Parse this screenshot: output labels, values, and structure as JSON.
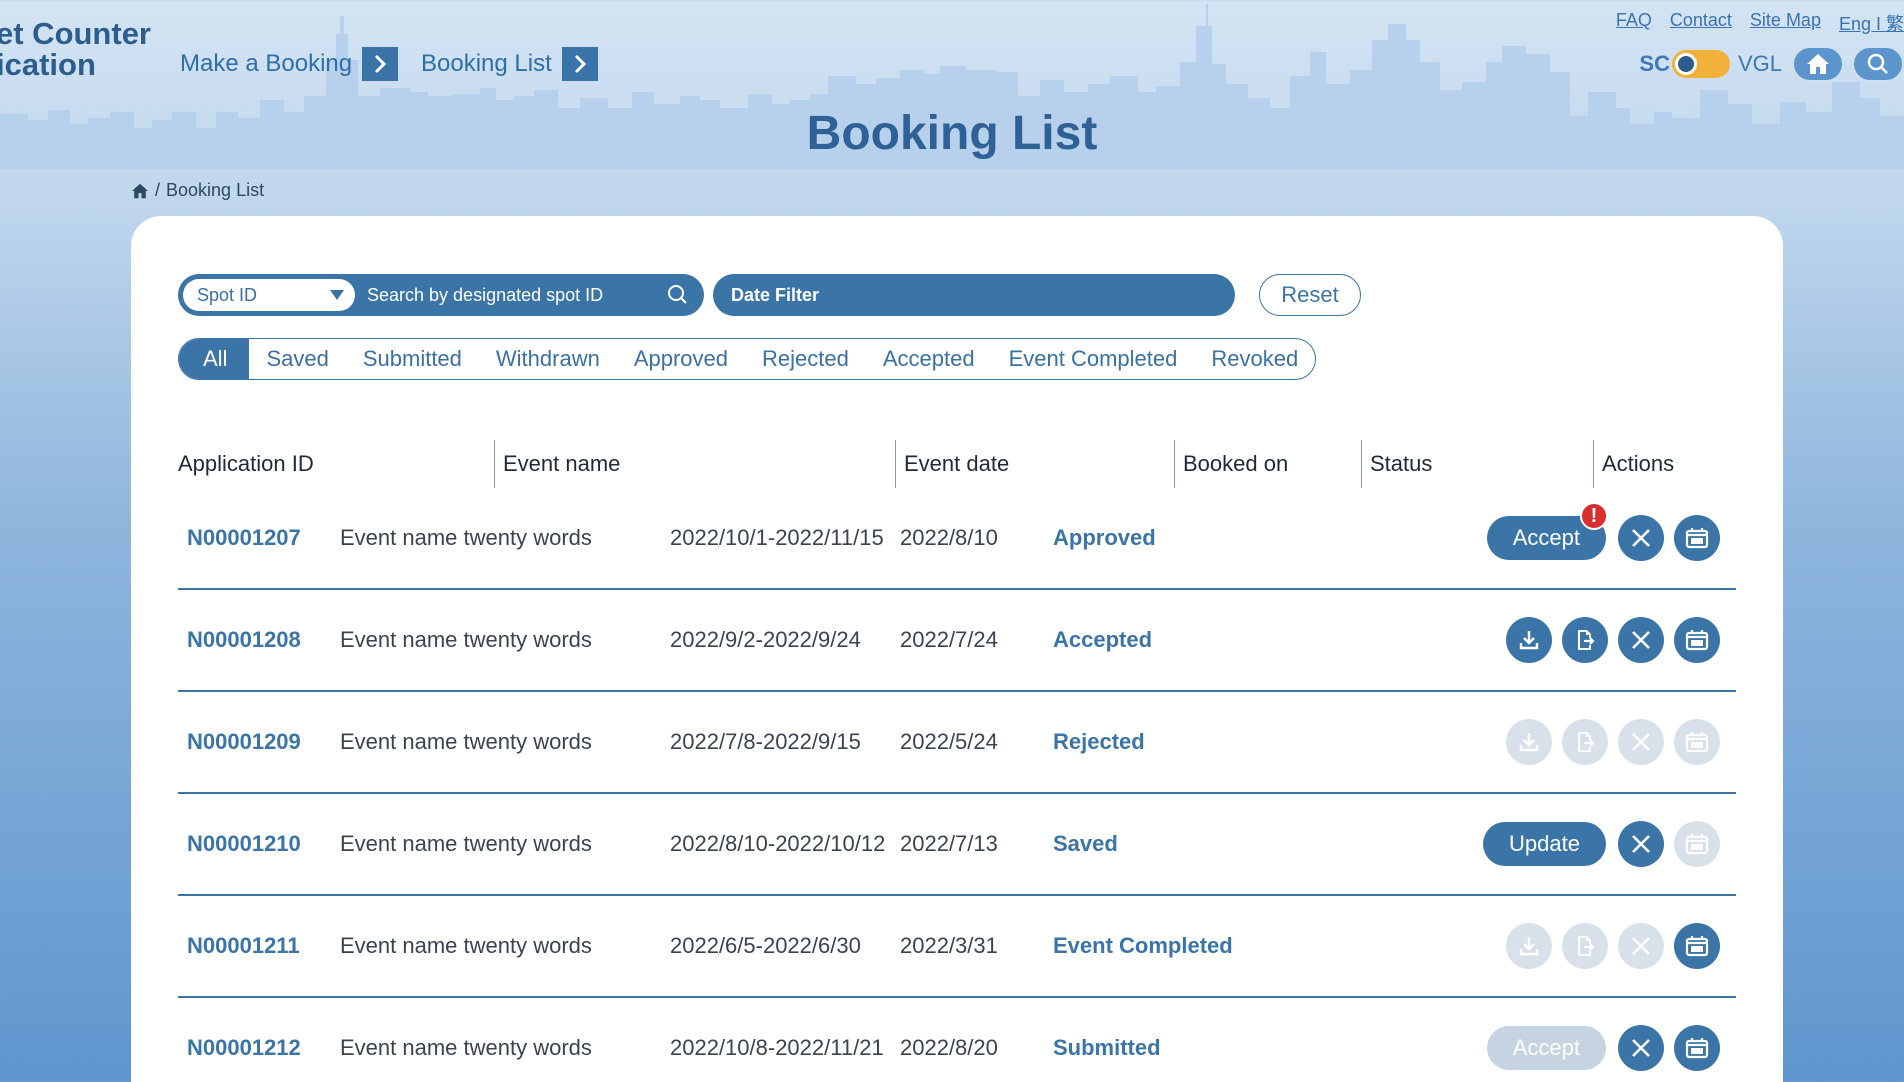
{
  "brand": {
    "line1": "et Counter",
    "line2": "ication"
  },
  "nav": {
    "make_booking": "Make a Booking",
    "booking_list": "Booking List"
  },
  "toplinks": {
    "faq": "FAQ",
    "contact": "Contact",
    "sitemap": "Site Map",
    "lang": "Eng I 繁"
  },
  "lang_toggle": {
    "left": "SC",
    "right": "VGL"
  },
  "page_title": "Booking List",
  "breadcrumb": {
    "current": "Booking List",
    "separator": "/"
  },
  "search": {
    "select_value": "Spot ID",
    "placeholder": "Search by designated spot ID"
  },
  "date_filter": "Date Filter",
  "reset": "Reset",
  "tabs": [
    {
      "label": "All",
      "active": true
    },
    {
      "label": "Saved"
    },
    {
      "label": "Submitted"
    },
    {
      "label": "Withdrawn"
    },
    {
      "label": "Approved"
    },
    {
      "label": "Rejected"
    },
    {
      "label": "Accepted"
    },
    {
      "label": "Event Completed"
    },
    {
      "label": "Revoked"
    }
  ],
  "table": {
    "headers": [
      "Application ID",
      "Event name",
      "Event date",
      "Booked on",
      "Status",
      "Actions"
    ],
    "rows": [
      {
        "id": "N00001207",
        "event": "Event name twenty words",
        "date": "2022/10/1-2022/11/15",
        "booked": "2022/8/10",
        "status": "Approved",
        "pill": "Accept",
        "pill_enabled": true,
        "alert": "!",
        "download": null,
        "export": null,
        "cancel": true,
        "calendar": true
      },
      {
        "id": "N00001208",
        "event": "Event name twenty words",
        "date": "2022/9/2-2022/9/24",
        "booked": "2022/7/24",
        "status": "Accepted",
        "pill": null,
        "download": true,
        "export": true,
        "cancel": true,
        "calendar": true
      },
      {
        "id": "N00001209",
        "event": "Event name twenty words",
        "date": "2022/7/8-2022/9/15",
        "booked": "2022/5/24",
        "status": "Rejected",
        "pill": null,
        "download": false,
        "export": false,
        "cancel": false,
        "calendar": false
      },
      {
        "id": "N00001210",
        "event": "Event name twenty words",
        "date": "2022/8/10-2022/10/12",
        "booked": "2022/7/13",
        "status": "Saved",
        "pill": "Update",
        "pill_enabled": true,
        "download": null,
        "export": null,
        "cancel": true,
        "calendar": false
      },
      {
        "id": "N00001211",
        "event": "Event name twenty words",
        "date": "2022/6/5-2022/6/30",
        "booked": "2022/3/31",
        "status": "Event Completed",
        "pill": null,
        "download": false,
        "export": false,
        "cancel": false,
        "calendar": true
      },
      {
        "id": "N00001212",
        "event": "Event name twenty words",
        "date": "2022/10/8-2022/11/21",
        "booked": "2022/8/20",
        "status": "Submitted",
        "pill": "Accept",
        "pill_enabled": false,
        "download": null,
        "export": null,
        "cancel": true,
        "calendar": true
      }
    ]
  },
  "colors": {
    "primary": "#3b74a6",
    "disabled": "#d8e1ea",
    "alert": "#d92f2f",
    "toggle": "#f2b13a"
  }
}
